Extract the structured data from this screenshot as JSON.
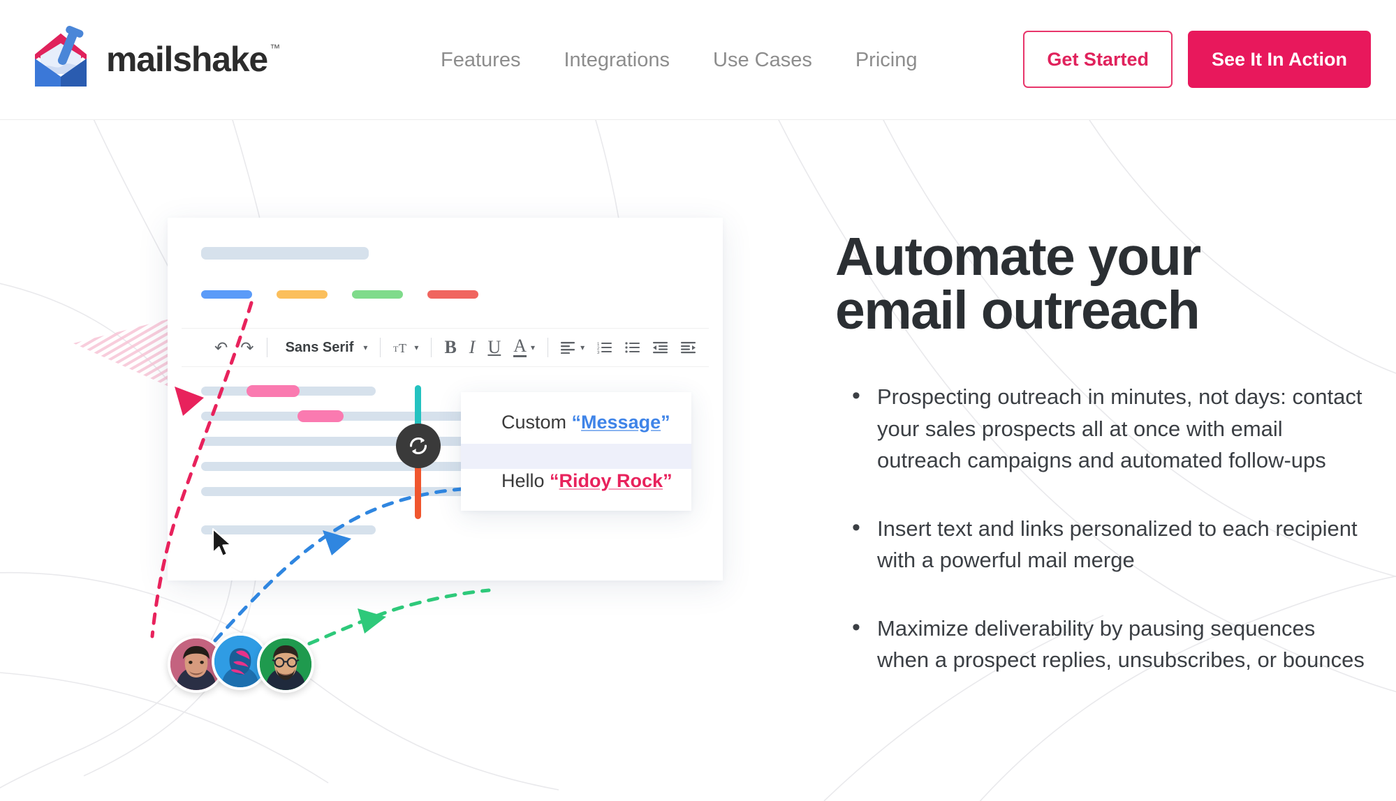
{
  "header": {
    "logo": {
      "name": "mailshake",
      "trademark": "™",
      "icon": "envelope-shake-logo"
    },
    "nav": [
      {
        "label": "Features",
        "name": "nav-link-features"
      },
      {
        "label": "Integrations",
        "name": "nav-link-integrations"
      },
      {
        "label": "Use Cases",
        "name": "nav-link-use-cases"
      },
      {
        "label": "Pricing",
        "name": "nav-link-pricing"
      }
    ],
    "buttons": {
      "get_started": "Get Started",
      "see_it_in_action": "See It In Action"
    }
  },
  "colors": {
    "accent_pink": "#e8185c",
    "accent_pink_outline": "#e0225c",
    "nav_gray": "#8d8d8d",
    "heading": "#2b2f33",
    "body": "#3b3f44",
    "bar_blue_gray": "#d6e1ec",
    "tag_blue": "#5b9bf8",
    "tag_yellow": "#fbbf5c",
    "tag_green": "#7fdb8b",
    "tag_red": "#f0655f",
    "highlight_pink": "#fa7ab0",
    "teal": "#24c2c0",
    "orange": "#f0562e",
    "arrow_pink": "#e8225c",
    "arrow_blue": "#2f86e0",
    "arrow_green": "#2ec97a",
    "sync_circle": "#3a3a3a"
  },
  "main": {
    "headline_line1": "Automate your",
    "headline_line2": "email outreach",
    "bullets": [
      "Prospecting outreach in minutes, not days: contact your sales prospects all at once with email outreach campaigns and automated follow-ups",
      "Insert text and links personalized to each recipient with a powerful mail merge",
      "Maximize deliverability by pausing sequences when a prospect replies, unsubscribes, or bounces"
    ]
  },
  "illustration": {
    "editor": {
      "toolbar": {
        "undo": "↶",
        "redo": "↷",
        "font_family_value": "Sans Serif",
        "font_size_label": "T",
        "bold": "B",
        "italic": "I",
        "underline": "U",
        "text_color": "A",
        "align": "align-left-icon",
        "numbered_list": "numbered-list-icon",
        "bulleted_list": "bulleted-list-icon",
        "indent_decrease": "indent-decrease-icon",
        "indent_increase": "indent-increase-icon",
        "caret": "▾"
      },
      "tag_count": 4,
      "body_line_count": 6
    },
    "message_card": {
      "row_top_prefix": "Custom ",
      "row_top_open_quote": "“",
      "row_top_token": "Message",
      "row_top_close_quote": "”",
      "row_bottom_prefix": "Hello ",
      "row_bottom_open_quote": "“",
      "row_bottom_token": "Ridoy Rock",
      "row_bottom_close_quote": "”",
      "sync_icon": "sync-refresh-icon"
    },
    "avatars": [
      {
        "name": "avatar-recipient-1",
        "bg": "#c4637f"
      },
      {
        "name": "avatar-recipient-2",
        "bg": "#2f9ce4"
      },
      {
        "name": "avatar-recipient-3",
        "bg": "#1f9a4e"
      }
    ],
    "cursor": "mouse-pointer-cursor"
  }
}
